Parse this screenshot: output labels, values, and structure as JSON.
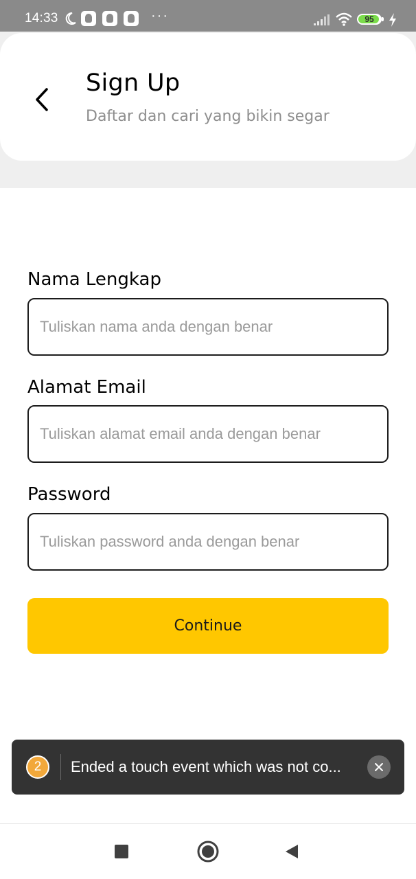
{
  "status_bar": {
    "time": "14:33",
    "more": "···",
    "battery": "95",
    "icons": [
      "moon-icon",
      "notification-icon",
      "notification-icon",
      "notification-icon",
      "signal-icon",
      "wifi-icon",
      "battery-icon",
      "charging-icon"
    ]
  },
  "header": {
    "back_icon": "chevron-left-icon",
    "title": "Sign Up",
    "subtitle": "Daftar dan cari yang bikin segar"
  },
  "form": {
    "name_label": "Nama Lengkap",
    "name_placeholder": "Tuliskan nama anda dengan benar",
    "email_label": "Alamat Email",
    "email_placeholder": "Tuliskan alamat email anda dengan benar",
    "password_label": "Password",
    "password_placeholder": "Tuliskan password anda dengan benar",
    "continue_label": "Continue"
  },
  "toast": {
    "count": "2",
    "message": "Ended a touch event which was not co...",
    "close_icon": "close-icon"
  },
  "nav": {
    "icons": [
      "recent-apps-icon",
      "home-icon",
      "back-icon"
    ]
  },
  "colors": {
    "accent": "#ffc700",
    "status_bar": "#8a8a8a",
    "toast_bg": "#333333",
    "toast_badge": "#f2a83a",
    "battery_fill": "#7bdc4b"
  }
}
